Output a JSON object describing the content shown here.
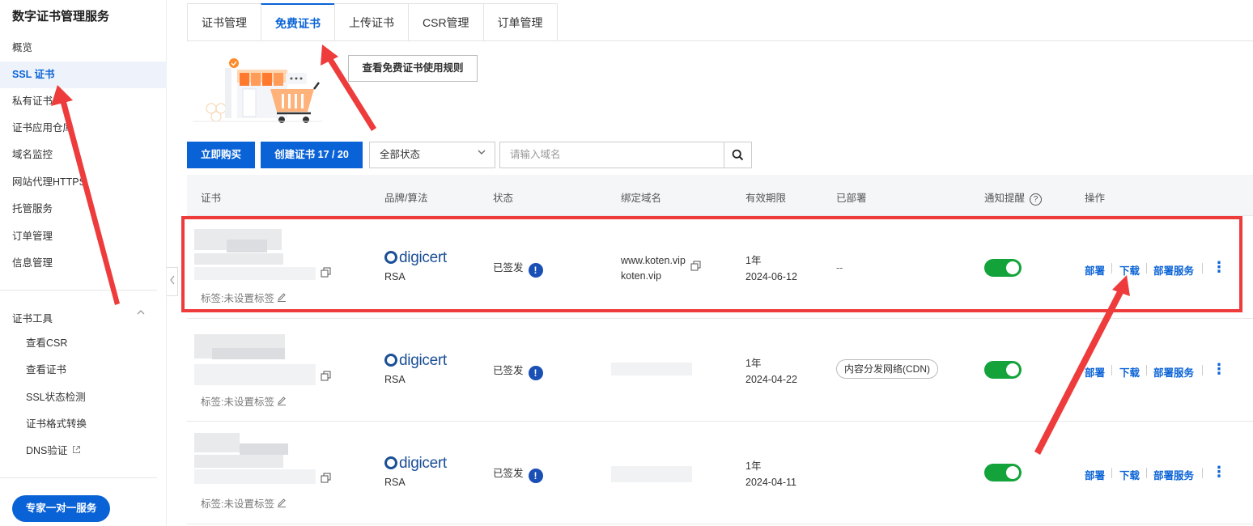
{
  "sidebar": {
    "title": "数字证书管理服务",
    "items": [
      {
        "label": "概览",
        "active": false
      },
      {
        "label": "SSL 证书",
        "active": true
      },
      {
        "label": "私有证书",
        "active": false
      },
      {
        "label": "证书应用仓库",
        "active": false
      },
      {
        "label": "域名监控",
        "active": false
      },
      {
        "label": "网站代理HTTPS",
        "active": false
      },
      {
        "label": "托管服务",
        "active": false
      },
      {
        "label": "订单管理",
        "active": false
      },
      {
        "label": "信息管理",
        "active": false
      }
    ],
    "group_label": "证书工具",
    "group_chevron": "chevron-up-icon",
    "tools": [
      {
        "label": "查看CSR"
      },
      {
        "label": "查看证书"
      },
      {
        "label": "SSL状态检测"
      },
      {
        "label": "证书格式转换"
      },
      {
        "label": "DNS验证",
        "external": true
      }
    ],
    "expert_button": "专家一对一服务"
  },
  "tabs": [
    {
      "label": "证书管理",
      "active": false
    },
    {
      "label": "免费证书",
      "active": true
    },
    {
      "label": "上传证书",
      "active": false
    },
    {
      "label": "CSR管理",
      "active": false
    },
    {
      "label": "订单管理",
      "active": false
    }
  ],
  "rules_button": "查看免费证书使用规则",
  "toolbar": {
    "buy_label": "立即购买",
    "create_label": "创建证书 17 / 20",
    "status_select": "全部状态",
    "search_placeholder": "请输入域名"
  },
  "table": {
    "headers": {
      "cert": "证书",
      "brand": "品牌/算法",
      "status": "状态",
      "domain": "绑定域名",
      "validity": "有效期限",
      "deployed": "已部署",
      "notify": "通知提醒",
      "ops": "操作"
    },
    "rows": [
      {
        "tag": "标签:未设置标签",
        "brand": "digicert",
        "algo": "RSA",
        "status": "已签发",
        "domains": [
          "www.koten.vip",
          "koten.vip"
        ],
        "validity_term": "1年",
        "validity_date": "2024-06-12",
        "deployed": "--",
        "notify": true
      },
      {
        "tag": "标签:未设置标签",
        "brand": "digicert",
        "algo": "RSA",
        "status": "已签发",
        "domains": [],
        "validity_term": "1年",
        "validity_date": "2024-04-22",
        "deployed": "内容分发网络(CDN)",
        "notify": true
      },
      {
        "tag": "标签:未设置标签",
        "brand": "digicert",
        "algo": "RSA",
        "status": "已签发",
        "domains": [],
        "validity_term": "1年",
        "validity_date": "2024-04-11",
        "deployed": "",
        "notify": true
      }
    ],
    "ops": {
      "deploy": "部署",
      "download": "下载",
      "deploy_service": "部署服务"
    }
  },
  "status_icon": "exclamation-icon",
  "copy_icon": "copy-icon",
  "edit_icon": "edit-icon",
  "colors": {
    "primary": "#0a63d6",
    "toggle_on": "#14a33a",
    "annotation_red": "#ee3b3b",
    "brand": "#1b4f96"
  }
}
